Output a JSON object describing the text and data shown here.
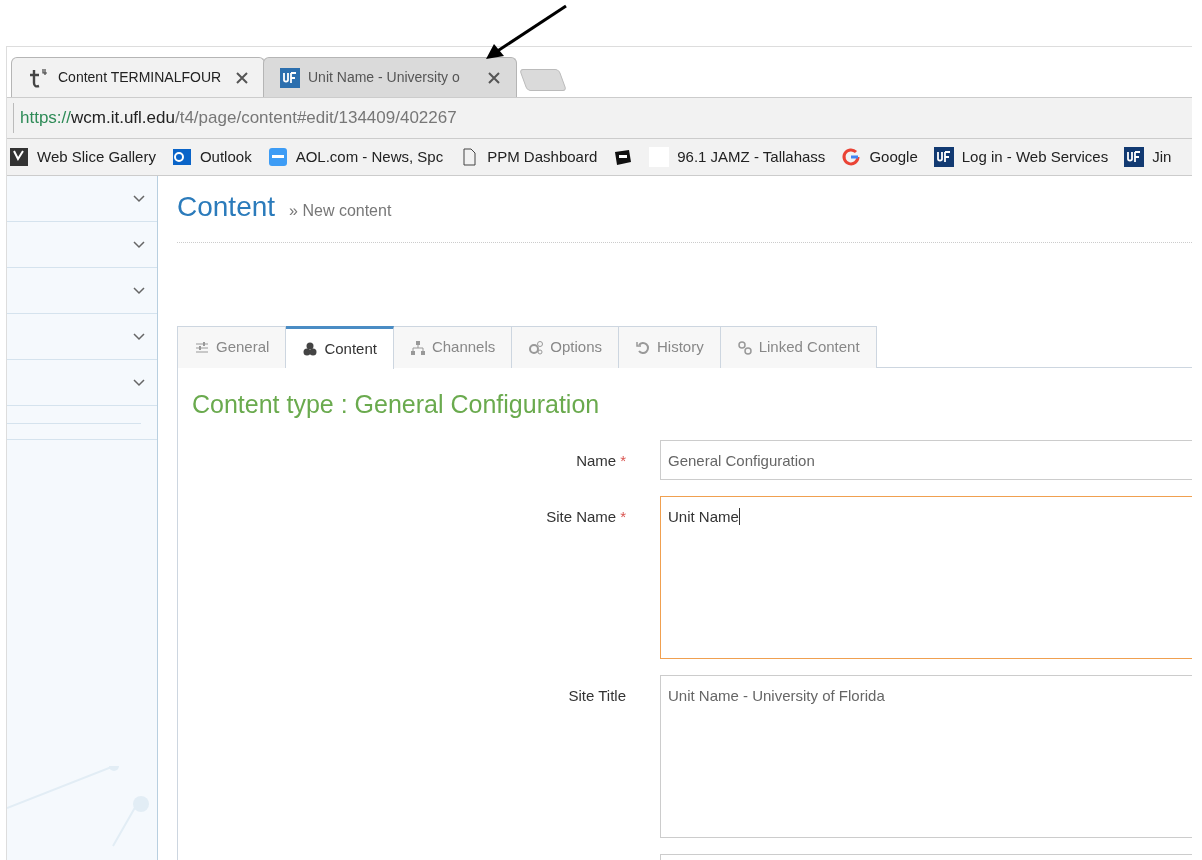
{
  "browser_tabs": [
    {
      "title": "Content TERMINALFOUR",
      "selected": true
    },
    {
      "title": "Unit Name - University o",
      "selected": false
    }
  ],
  "address_bar": {
    "scheme": "https://",
    "host": "wcm.it.ufl.edu",
    "path": "/t4/page/content#edit/134409/402267"
  },
  "bookmarks": [
    {
      "kind": "link",
      "label": "Web Slice Gallery"
    },
    {
      "kind": "link",
      "label": "Outlook"
    },
    {
      "kind": "link",
      "label": "AOL.com - News, Spc"
    },
    {
      "kind": "link",
      "label": "PPM Dashboard"
    },
    {
      "kind": "icon_only"
    },
    {
      "kind": "link",
      "label": "96.1 JAMZ - Tallahass"
    },
    {
      "kind": "link",
      "label": "Google"
    },
    {
      "kind": "link",
      "label": "Log in - Web Services"
    },
    {
      "kind": "link",
      "label": "Jin"
    }
  ],
  "sidebar": {
    "sections": [
      {
        "expanded": false
      },
      {
        "expanded": false
      },
      {
        "expanded": false
      },
      {
        "expanded": false
      },
      {
        "expanded": false
      }
    ]
  },
  "page": {
    "title": "Content",
    "breadcrumb": "» New content"
  },
  "content_tabs": [
    {
      "label": "General",
      "selected": false
    },
    {
      "label": "Content",
      "selected": true
    },
    {
      "label": "Channels",
      "selected": false
    },
    {
      "label": "Options",
      "selected": false
    },
    {
      "label": "History",
      "selected": false
    },
    {
      "label": "Linked Content",
      "selected": false
    }
  ],
  "heading": "Content type : General Configuration",
  "fields": [
    {
      "label": "Name",
      "required_mark": "*",
      "value": "General Configuration",
      "kind": "input",
      "focused": false
    },
    {
      "label": "Site Name",
      "required_mark": "*",
      "value": "Unit Name",
      "kind": "textarea",
      "focused": true
    },
    {
      "label": "Site Title",
      "value": "Unit Name - University of Florida",
      "kind": "textarea",
      "focused": false
    },
    {
      "kind": "textarea",
      "focused": false
    }
  ]
}
